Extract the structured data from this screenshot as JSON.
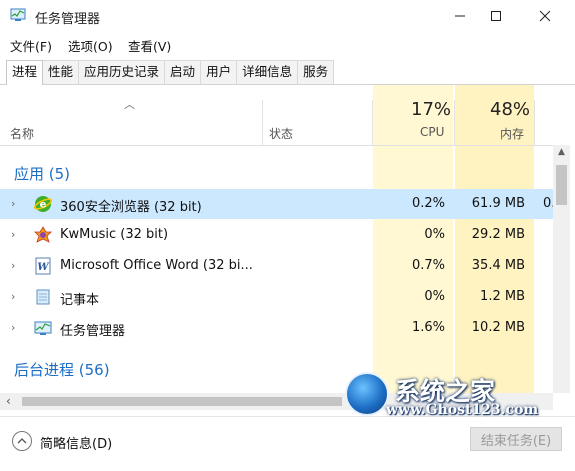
{
  "window": {
    "title": "任务管理器"
  },
  "menu": {
    "file": "文件(F)",
    "options": "选项(O)",
    "view": "查看(V)"
  },
  "tabs": [
    "进程",
    "性能",
    "应用历史记录",
    "启动",
    "用户",
    "详细信息",
    "服务"
  ],
  "columns": {
    "name": "名称",
    "status": "状态",
    "cpu_pct": "17%",
    "cpu": "CPU",
    "mem_pct": "48%",
    "mem": "内存"
  },
  "groups": {
    "apps": "应用 (5)",
    "background": "后台进程 (56)"
  },
  "rows": [
    {
      "name": "360安全浏览器 (32 bit)",
      "cpu": "0.2%",
      "mem": "61.9 MB",
      "extra": "0."
    },
    {
      "name": "KwMusic (32 bit)",
      "cpu": "0%",
      "mem": "29.2 MB"
    },
    {
      "name": "Microsoft Office Word (32 bi...",
      "cpu": "0.7%",
      "mem": "35.4 MB"
    },
    {
      "name": "记事本",
      "cpu": "0%",
      "mem": "1.2 MB"
    },
    {
      "name": "任务管理器",
      "cpu": "1.6%",
      "mem": "10.2 MB"
    }
  ],
  "footer": {
    "collapse": "简略信息(D)",
    "end_task": "结束任务(E)"
  },
  "watermark": {
    "text": "系统之家",
    "url": "www.Ghost123.com"
  },
  "icons": [
    "app-taskmgr-icon",
    "minimize-icon",
    "maximize-icon",
    "close-icon",
    "browser-360-icon",
    "kwmusic-icon",
    "word-icon",
    "notepad-icon",
    "taskmgr-icon",
    "chevron-up-icon"
  ],
  "colors": {
    "accent": "#1c6ec4",
    "selected_row": "#cce8ff",
    "cpu_column": "#fff8d2",
    "mem_column": "#fff3c2"
  }
}
